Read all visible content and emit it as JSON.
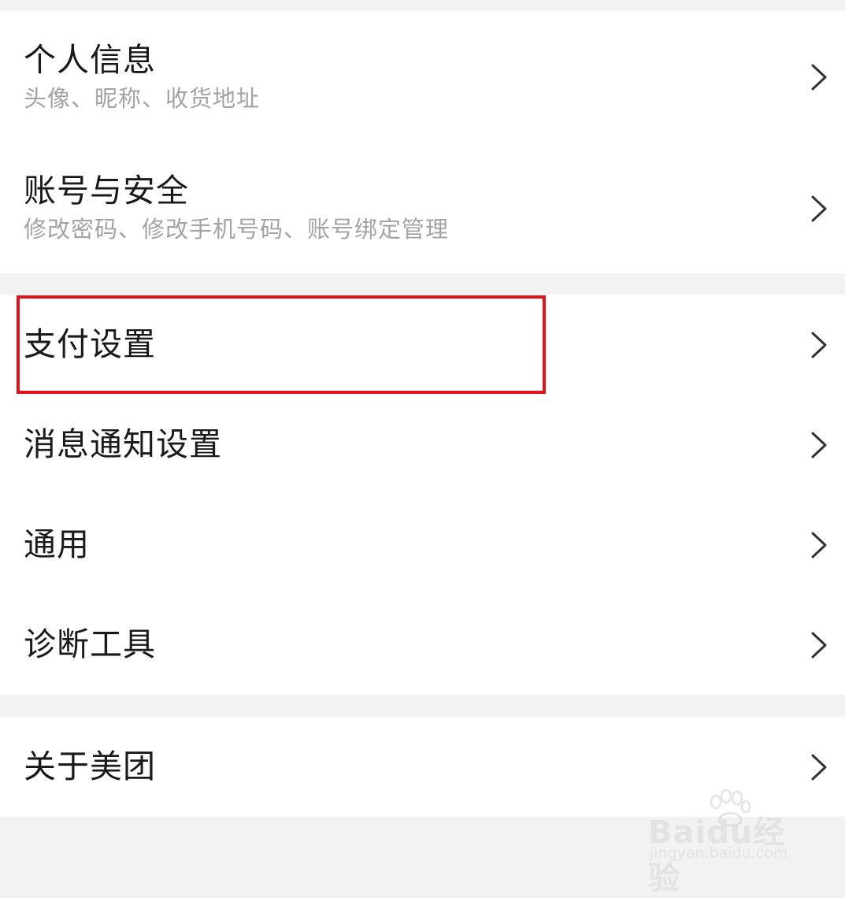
{
  "groups": [
    {
      "items": [
        {
          "title": "个人信息",
          "subtitle": "头像、昵称、收货地址"
        },
        {
          "title": "账号与安全",
          "subtitle": "修改密码、修改手机号码、账号绑定管理"
        }
      ]
    },
    {
      "items": [
        {
          "title": "支付设置"
        },
        {
          "title": "消息通知设置"
        },
        {
          "title": "通用"
        },
        {
          "title": "诊断工具"
        }
      ]
    },
    {
      "items": [
        {
          "title": "关于美团"
        }
      ]
    }
  ],
  "watermark": {
    "main": "Baidu经验",
    "sub": "jingyan.baidu.com"
  },
  "colors": {
    "highlight": "#e1141a",
    "background": "#f2f2f2",
    "title_text": "#1a1a1a",
    "subtitle_text": "#a3a3a3"
  }
}
